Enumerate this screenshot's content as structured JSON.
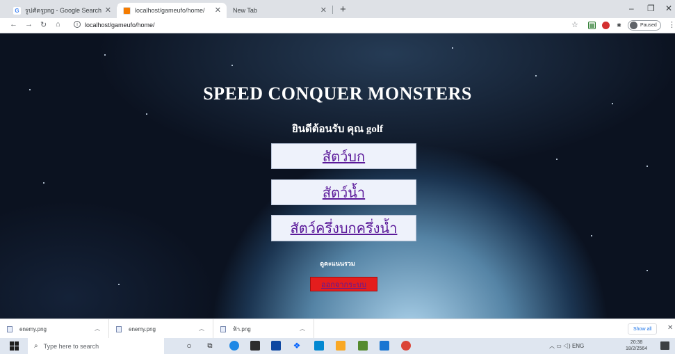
{
  "browser": {
    "tabs": [
      {
        "label": "รูปศัตรูpng - Google Search",
        "favicon": "G",
        "active": false
      },
      {
        "label": "localhost/gameufo/home/",
        "favicon": "",
        "active": true
      },
      {
        "label": "New Tab",
        "favicon": "",
        "active": false
      }
    ],
    "new_tab_symbol": "+",
    "window_controls": {
      "minimize": "–",
      "maximize": "❐",
      "close": "✕"
    },
    "url": "localhost/gameufo/home/",
    "profile_label": "Paused"
  },
  "page": {
    "title": "SPEED CONQUER MONSTERS",
    "welcome": "ยินดีต้อนรับ คุณ golf",
    "menu": {
      "bird": "สัตว์บก",
      "water": "สัตว์น้ำ",
      "amphibian": "สัตว์ครึ่งบกครึ่งน้ำ"
    },
    "scores_link": "ดูคะแนนรวม",
    "logout": "ออกจากระบบ",
    "colors": {
      "link": "#5b1a9a",
      "logout_bg": "#e41d1d",
      "menu_bg": "#eef2fb"
    }
  },
  "downloads": {
    "items": [
      {
        "name": "enemy.png"
      },
      {
        "name": "enemy.png"
      },
      {
        "name": "ฟ้า.png"
      }
    ],
    "show_all": "Show all",
    "close": "✕"
  },
  "taskbar": {
    "search_placeholder": "Type here to search",
    "tray_lang": "ENG",
    "time": "20:38",
    "date": "18/2/2564"
  }
}
